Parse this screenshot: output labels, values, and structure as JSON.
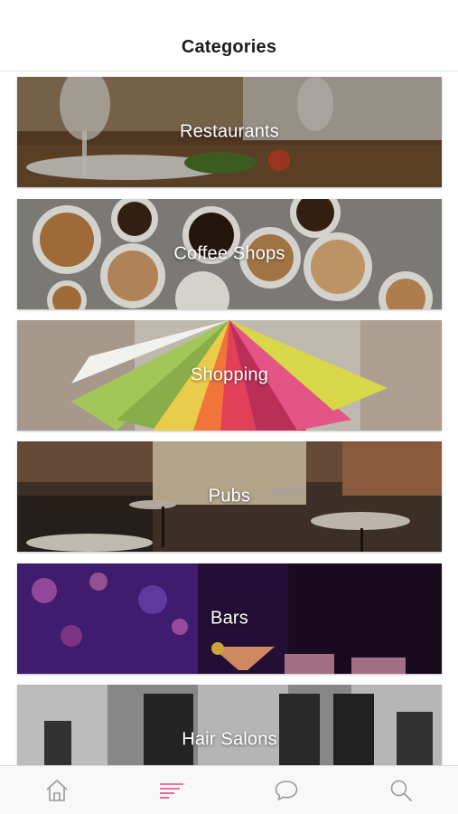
{
  "header": {
    "title": "Categories"
  },
  "categories": [
    {
      "label": "Restaurants"
    },
    {
      "label": "Coffee Shops"
    },
    {
      "label": "Shopping"
    },
    {
      "label": "Pubs"
    },
    {
      "label": "Bars"
    },
    {
      "label": "Hair Salons"
    }
  ],
  "tabbar": {
    "items": [
      {
        "icon": "home-icon",
        "active": false
      },
      {
        "icon": "categories-list-icon",
        "active": true
      },
      {
        "icon": "chat-bubble-icon",
        "active": false
      },
      {
        "icon": "search-icon",
        "active": false
      }
    ]
  },
  "colors": {
    "accent": "#e8467c",
    "icon_inactive": "#9a9a9a"
  }
}
